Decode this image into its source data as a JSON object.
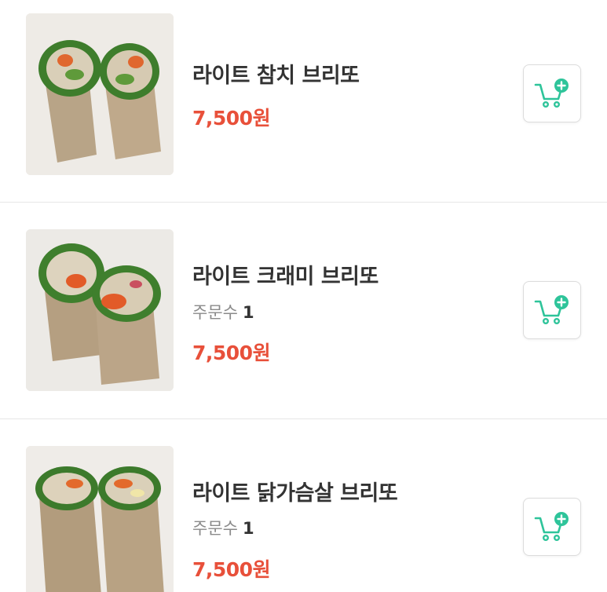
{
  "colors": {
    "price": "#e8503a",
    "accent": "#2ec49a",
    "name": "#333333",
    "muted": "#8a8a8a"
  },
  "items": [
    {
      "name": "라이트 참치 브리또",
      "orders_label": "",
      "orders_count": "",
      "price": "7,500원",
      "image": "burrito-photo",
      "cart_icon": "cart-add-icon"
    },
    {
      "name": "라이트 크래미 브리또",
      "orders_label": "주문수",
      "orders_count": "1",
      "price": "7,500원",
      "image": "burrito-photo",
      "cart_icon": "cart-add-icon"
    },
    {
      "name": "라이트 닭가슴살 브리또",
      "orders_label": "주문수",
      "orders_count": "1",
      "price": "7,500원",
      "image": "burrito-photo",
      "cart_icon": "cart-add-icon"
    }
  ]
}
